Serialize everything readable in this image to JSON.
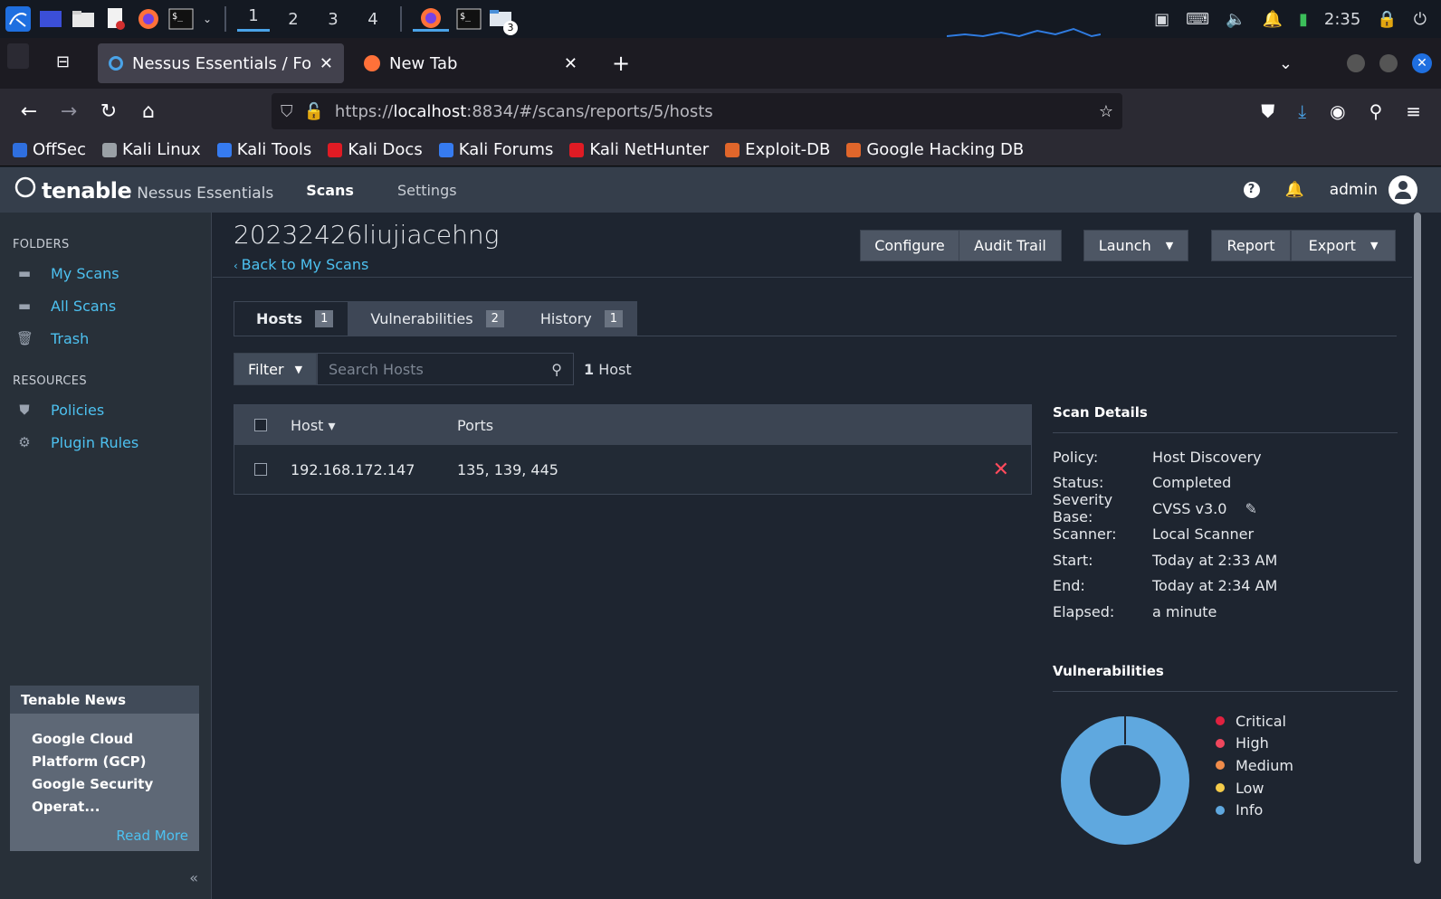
{
  "taskbar": {
    "workspaces": [
      "1",
      "2",
      "3",
      "4"
    ],
    "folder_badge": "3",
    "clock": "2:35"
  },
  "browser": {
    "tabs": [
      {
        "title": "Nessus Essentials / Folde"
      },
      {
        "title": "New Tab"
      }
    ],
    "url_prefix": "https://",
    "url_host": "localhost",
    "url_rest": ":8834/#/scans/reports/5/hosts",
    "bookmarks": [
      {
        "label": "OffSec",
        "color": "#2f6fdf"
      },
      {
        "label": "Kali Linux",
        "color": "#9aa0a6"
      },
      {
        "label": "Kali Tools",
        "color": "#367bf0"
      },
      {
        "label": "Kali Docs",
        "color": "#e01b24"
      },
      {
        "label": "Kali Forums",
        "color": "#367bf0"
      },
      {
        "label": "Kali NetHunter",
        "color": "#e01b24"
      },
      {
        "label": "Exploit-DB",
        "color": "#e0662b"
      },
      {
        "label": "Google Hacking DB",
        "color": "#e0662b"
      }
    ]
  },
  "app": {
    "brand": "tenable",
    "product": "Nessus Essentials",
    "nav": {
      "scans": "Scans",
      "settings": "Settings"
    },
    "user": "admin"
  },
  "sidebar": {
    "folders_heading": "FOLDERS",
    "folders": [
      {
        "label": "My Scans"
      },
      {
        "label": "All Scans"
      },
      {
        "label": "Trash"
      }
    ],
    "resources_heading": "RESOURCES",
    "resources": [
      {
        "label": "Policies"
      },
      {
        "label": "Plugin Rules"
      }
    ],
    "news": {
      "heading": "Tenable News",
      "body": "Google Cloud Platform (GCP) Google Security Operat...",
      "more": "Read More"
    },
    "collapse": "«"
  },
  "main": {
    "title": "20232426liujiacehng",
    "back": "Back to My Scans",
    "buttons": {
      "configure": "Configure",
      "audit": "Audit Trail",
      "launch": "Launch",
      "report": "Report",
      "export": "Export"
    },
    "tabs": [
      {
        "label": "Hosts",
        "count": "1"
      },
      {
        "label": "Vulnerabilities",
        "count": "2"
      },
      {
        "label": "History",
        "count": "1"
      }
    ],
    "filter": "Filter",
    "search_placeholder": "Search Hosts",
    "host_count_num": "1",
    "host_count_word": "Host",
    "table": {
      "headers": {
        "host": "Host ▾",
        "ports": "Ports"
      },
      "rows": [
        {
          "host": "192.168.172.147",
          "ports": "135, 139, 445"
        }
      ]
    }
  },
  "details": {
    "heading": "Scan Details",
    "rows": [
      {
        "key": "Policy:",
        "value": "Host Discovery"
      },
      {
        "key": "Status:",
        "value": "Completed"
      },
      {
        "key": "Severity Base:",
        "value": "CVSS v3.0"
      },
      {
        "key": "Scanner:",
        "value": "Local Scanner"
      },
      {
        "key": "Start:",
        "value": "Today at 2:33 AM"
      },
      {
        "key": "End:",
        "value": "Today at 2:34 AM"
      },
      {
        "key": "Elapsed:",
        "value": "a minute"
      }
    ]
  },
  "vulnerabilities": {
    "heading": "Vulnerabilities",
    "legend": [
      {
        "label": "Critical",
        "color": "#e0213f"
      },
      {
        "label": "High",
        "color": "#f0475d"
      },
      {
        "label": "Medium",
        "color": "#f08c4a"
      },
      {
        "label": "Low",
        "color": "#f5cc4a"
      },
      {
        "label": "Info",
        "color": "#5fa8df"
      }
    ],
    "donut_color": "#5fa8df"
  }
}
